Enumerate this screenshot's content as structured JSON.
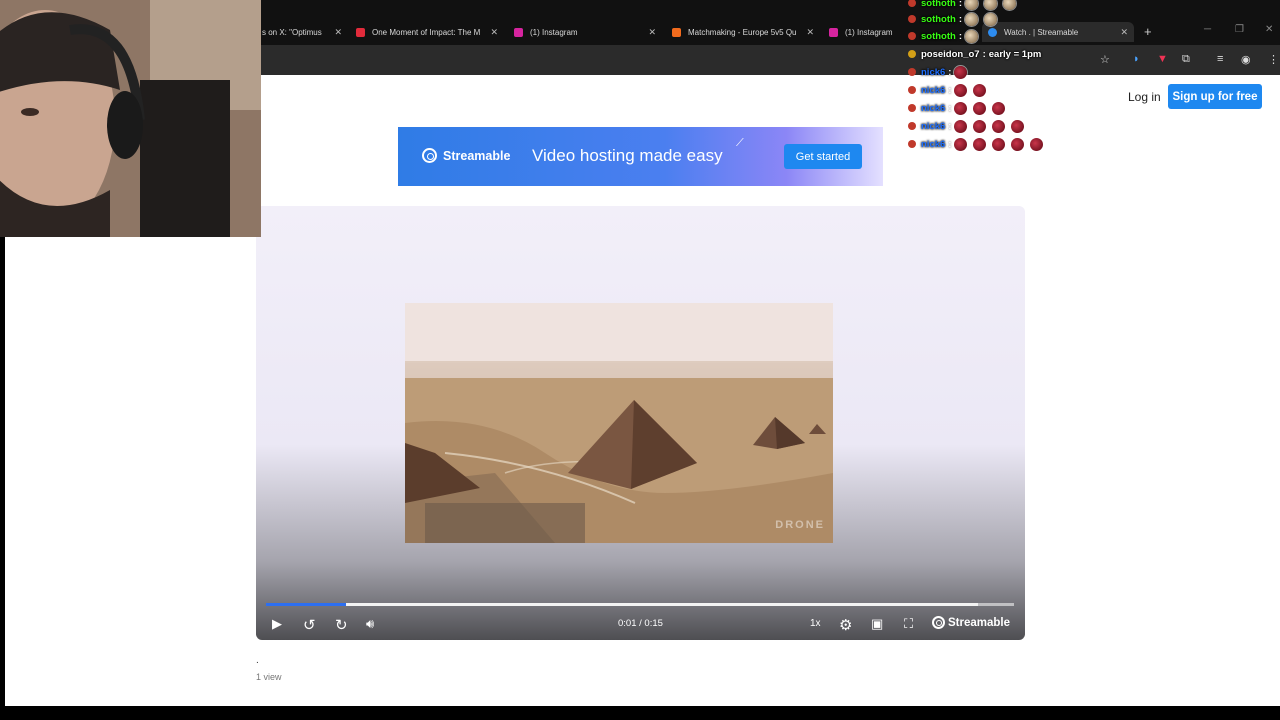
{
  "browser": {
    "tabs": [
      {
        "label": "s on X: \"Optimus",
        "favicon_color": "#000000",
        "closable": true
      },
      {
        "label": "One Moment of Impact: The M",
        "favicon_color": "#e22b3b",
        "closable": true
      },
      {
        "label": "(1) Instagram",
        "favicon_color": "#d6249f",
        "closable": true
      },
      {
        "label": "Matchmaking - Europe 5v5 Qu",
        "favicon_color": "#f26b1d",
        "closable": true
      },
      {
        "label": "(1) Instagram",
        "favicon_color": "#d6249f",
        "closable": false
      },
      {
        "label": "Watch . | Streamable",
        "favicon_color": "#2d8cf0",
        "closable": true,
        "active": true
      }
    ],
    "new_tab_icon": "plus-icon",
    "new_tab_glyph": "+"
  },
  "header": {
    "login_label": "Log in",
    "signup_label": "Sign up for free"
  },
  "banner": {
    "brand": "Streamable",
    "tagline": "Video hosting made easy",
    "cta_label": "Get started"
  },
  "player": {
    "time_display": "0:01 / 0:15",
    "current_seconds": 1,
    "duration_seconds": 15,
    "progress_fraction": 0.107,
    "buffered_fraction": 0.952,
    "speed_label": "1x",
    "brand_label": "Streamable",
    "watermark": "DRONE",
    "accent_color": "#2d6ff0"
  },
  "video_meta": {
    "title": ".",
    "views": "1 view"
  },
  "chat": [
    {
      "user": "sothoth",
      "color": "#39ff14",
      "badge": "#c0392b",
      "message": "",
      "emotes": 3,
      "emote_type": "pepe"
    },
    {
      "user": "sothoth",
      "color": "#39ff14",
      "badge": "#c0392b",
      "message": "",
      "emotes": 2,
      "emote_type": "pepe"
    },
    {
      "user": "sothoth",
      "color": "#39ff14",
      "badge": "#c0392b",
      "message": "",
      "emotes": 1,
      "emote_type": "pepe"
    },
    {
      "user": "poseidon_o7",
      "color": "#ffffff",
      "badge": "#d4a017",
      "message": "early = 1pm",
      "emotes": 0,
      "emote_type": ""
    },
    {
      "user": "nick6",
      "color": "#1e6fff",
      "badge": "#c0392b",
      "message": "",
      "emotes": 1,
      "emote_type": "red"
    },
    {
      "user": "nick6",
      "color": "#1e6fff",
      "badge": "#c0392b",
      "message": "",
      "emotes": 2,
      "emote_type": "red"
    },
    {
      "user": "nick6",
      "color": "#1e6fff",
      "badge": "#c0392b",
      "message": "",
      "emotes": 3,
      "emote_type": "red"
    },
    {
      "user": "nick6",
      "color": "#1e6fff",
      "badge": "#c0392b",
      "message": "",
      "emotes": 4,
      "emote_type": "red"
    },
    {
      "user": "nick6",
      "color": "#1e6fff",
      "badge": "#c0392b",
      "message": "",
      "emotes": 5,
      "emote_type": "red"
    }
  ]
}
